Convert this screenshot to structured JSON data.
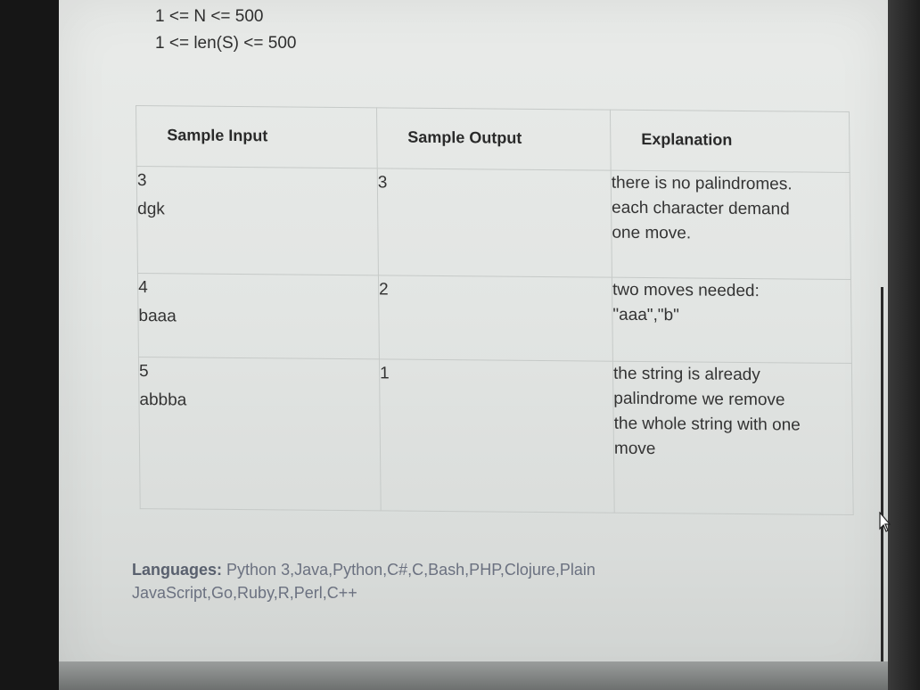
{
  "constraints": [
    "1 <= N <= 500",
    "1 <= len(S) <= 500"
  ],
  "table": {
    "headers": [
      "Sample Input",
      "Sample Output",
      "Explanation"
    ],
    "rows": [
      {
        "input_n": "3",
        "input_s": "dgk",
        "output": "3",
        "explanation": [
          "there is no palindromes.",
          "each character demand",
          "one move."
        ]
      },
      {
        "input_n": "4",
        "input_s": "baaa",
        "output": "2",
        "explanation": [
          "two moves needed:",
          "\"aaa\",\"b\""
        ]
      },
      {
        "input_n": "5",
        "input_s": "abbba",
        "output": "1",
        "explanation": [
          "the string is already",
          "palindrome we remove",
          "the whole string with one",
          "move"
        ]
      }
    ]
  },
  "languages": {
    "label": "Languages:",
    "value": "Python 3,Java,Python,C#,C,Bash,PHP,Clojure,Plain JavaScript,Go,Ruby,R,Perl,C++"
  }
}
